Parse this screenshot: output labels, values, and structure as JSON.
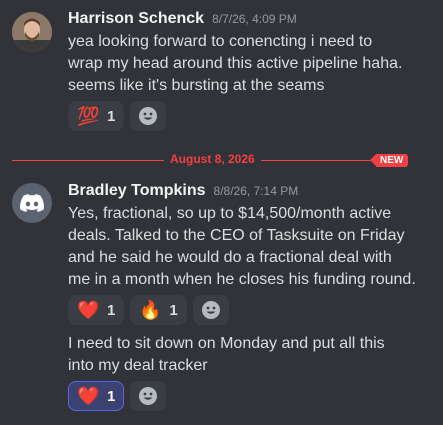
{
  "messages": [
    {
      "username": "Harrison Schenck",
      "timestamp": "8/7/26, 4:09 PM",
      "lines": [
        "yea looking forward to conencting i need to",
        "wrap my head around this active pipeline haha.",
        "seems like it's bursting at the seams"
      ],
      "reactions": [
        {
          "emoji": "💯",
          "count": "1"
        }
      ]
    },
    {
      "username": "Bradley Tompkins",
      "timestamp": "8/8/26, 7:14 PM",
      "lines": [
        "Yes, fractional, so up to $14,500/month active",
        "deals. Talked to the CEO of Tasksuite on Friday",
        "and he said he would do a fractional deal with",
        "me in a month when he closes his funding round."
      ],
      "reactions": [
        {
          "emoji": "❤️",
          "count": "1"
        },
        {
          "emoji": "🔥",
          "count": "1"
        }
      ],
      "followup_lines": [
        "I need to sit down on Monday and put all this",
        "into my deal tracker"
      ],
      "followup_reactions": [
        {
          "emoji": "❤️",
          "count": "1",
          "active": true
        }
      ]
    }
  ],
  "divider": {
    "date": "August 8, 2026",
    "badge": "NEW"
  },
  "colors": {
    "background": "#313338",
    "accent_red": "#f23f43",
    "blurple": "#5865f2"
  },
  "icons": {
    "add_reaction": "smiley-add-reaction-icon",
    "discord_avatar": "discord-logo-icon"
  }
}
